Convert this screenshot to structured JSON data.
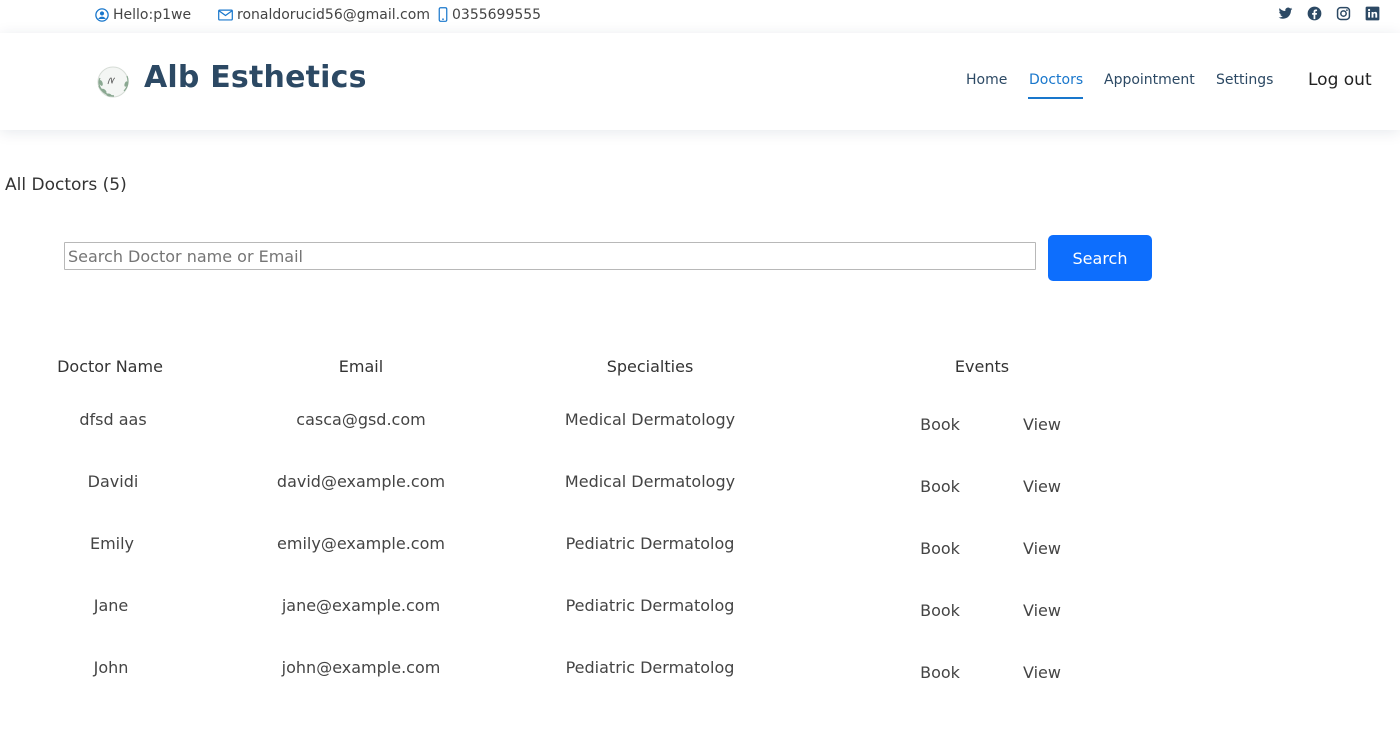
{
  "topbar": {
    "greeting": "Hello:p1we",
    "email": "ronaldorucid56@gmail.com",
    "phone": "0355699555",
    "socials": [
      "twitter-icon",
      "facebook-icon",
      "instagram-icon",
      "linkedin-icon"
    ]
  },
  "header": {
    "brand": "Alb Esthetics",
    "nav": {
      "home": "Home",
      "doctors": "Doctors",
      "appointment": "Appointment",
      "settings": "Settings",
      "logout": "Log out"
    },
    "active_nav": "Doctors"
  },
  "main": {
    "title": "All Doctors (5)",
    "search": {
      "placeholder": "Search Doctor name or Email",
      "value": "",
      "button": "Search"
    },
    "table": {
      "headers": [
        "Doctor Name",
        "Email",
        "Specialties",
        "Events"
      ],
      "rows": [
        {
          "name": "dfsd aas",
          "email": "casca@gsd.com",
          "specialty": "Medical Dermatology",
          "book": "Book",
          "view": "View"
        },
        {
          "name": "Davidi",
          "email": "david@example.com",
          "specialty": "Medical Dermatology",
          "book": "Book",
          "view": "View"
        },
        {
          "name": "Emily",
          "email": "emily@example.com",
          "specialty": "Pediatric Dermatolog",
          "book": "Book",
          "view": "View"
        },
        {
          "name": "Jane",
          "email": "jane@example.com",
          "specialty": "Pediatric Dermatolog",
          "book": "Book",
          "view": "View"
        },
        {
          "name": "John",
          "email": "john@example.com",
          "specialty": "Pediatric Dermatolog",
          "book": "Book",
          "view": "View"
        }
      ]
    }
  },
  "colors": {
    "accent": "#1977cc",
    "brand_text": "#2c4964",
    "primary_button": "#0d6efd"
  }
}
